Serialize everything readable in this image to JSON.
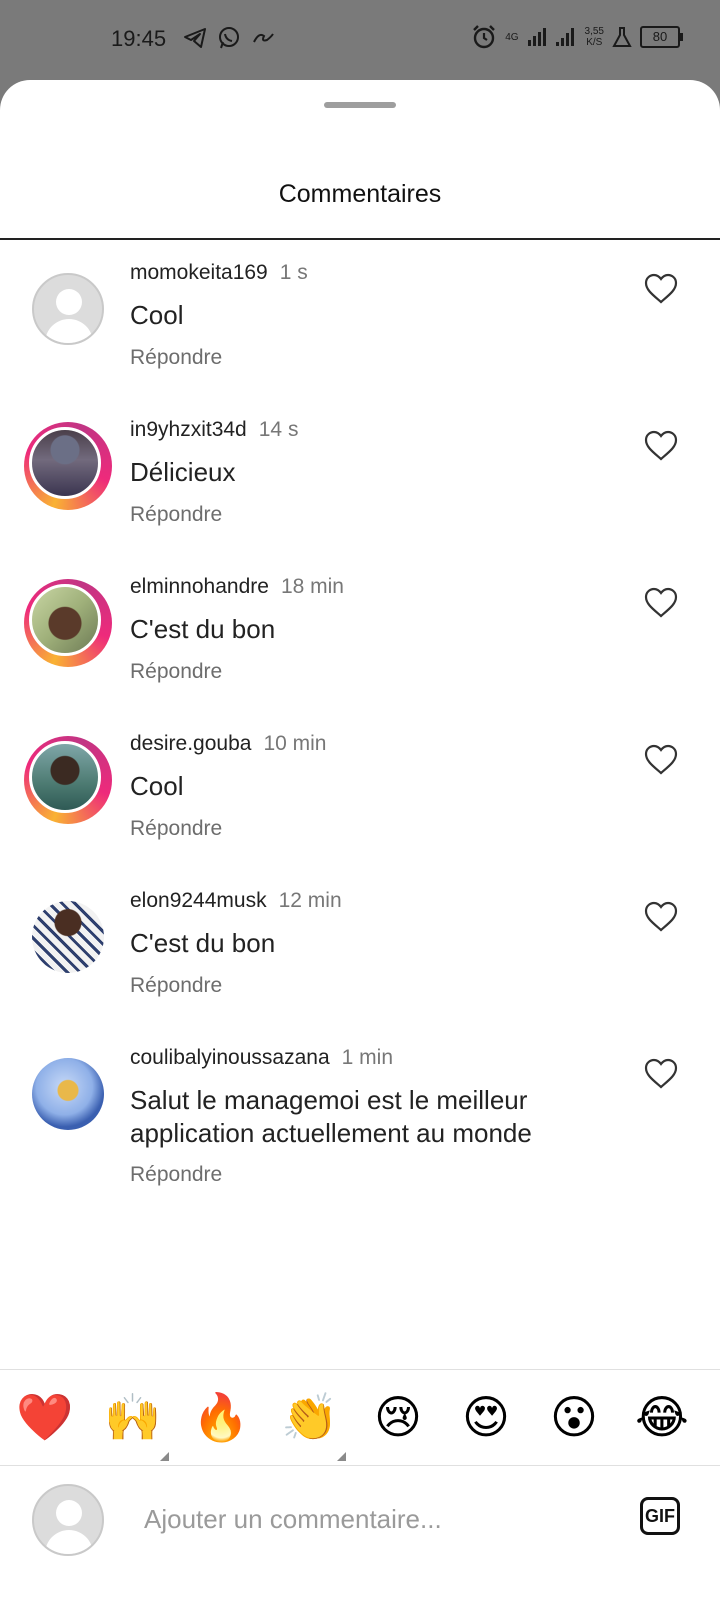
{
  "status_bar": {
    "time": "19:45",
    "network": "4G",
    "speed_value": "3,55",
    "speed_unit": "K/S",
    "battery": "80",
    "icons": [
      "telegram-icon",
      "whatsapp-icon",
      "chain-icon",
      "alarm-icon",
      "signal-icon",
      "signal-icon",
      "lab-flask-icon",
      "battery-icon"
    ]
  },
  "sheet": {
    "title": "Commentaires"
  },
  "comments": [
    {
      "username": "momokeita169",
      "time": "1 s",
      "text": "Cool",
      "reply": "Répondre",
      "avatar": "default"
    },
    {
      "username": "in9yhzxit34d",
      "time": "14 s",
      "text": "Délicieux",
      "reply": "Répondre",
      "avatar": "story-photo"
    },
    {
      "username": "elminnohandre",
      "time": "18 min",
      "text": "C'est du bon",
      "reply": "Répondre",
      "avatar": "story-photo"
    },
    {
      "username": "desire.gouba",
      "time": "10 min",
      "text": "Cool",
      "reply": "Répondre",
      "avatar": "story-photo"
    },
    {
      "username": "elon9244musk",
      "time": "12 min",
      "text": "C'est du bon",
      "reply": "Répondre",
      "avatar": "photo"
    },
    {
      "username": "coulibalyinoussazana",
      "time": "1 min",
      "text": "Salut le managemoi est le meilleur application actuellement au monde",
      "reply": "Répondre",
      "avatar": "photo"
    }
  ],
  "emoji_bar": [
    "❤️",
    "🙌",
    "🔥",
    "👏",
    "😢",
    "😍",
    "😮",
    "😂"
  ],
  "composer": {
    "placeholder": "Ajouter un commentaire...",
    "gif_label": "GIF"
  },
  "colors": {
    "story_ring_start": "#f9b233",
    "story_ring_end": "#c13584",
    "secondary_text": "#777777",
    "background": "#ffffff"
  }
}
